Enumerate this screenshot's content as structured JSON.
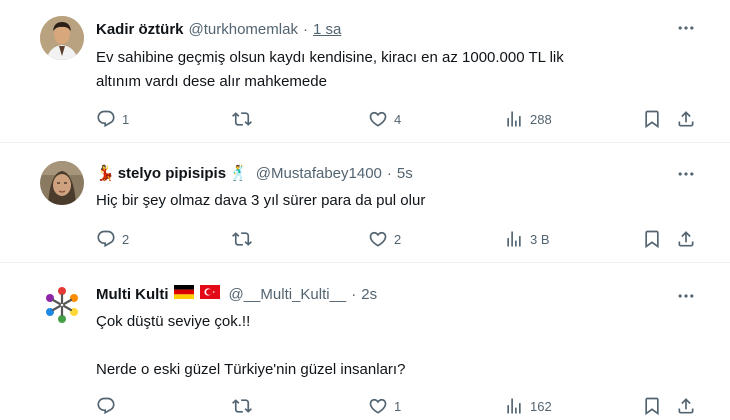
{
  "posts": [
    {
      "name": "Kadir öztürk",
      "handle": "@turkhomemlak",
      "separator": "·",
      "time": "1 sa",
      "text": [
        "Ev sahibine geçmiş olsun kaydı kendisine, kiracı en az 1000.000 TL lik",
        "altınım vardı dese alır mahkemede"
      ],
      "replies": "1",
      "reposts": "",
      "likes": "4",
      "views": "288"
    },
    {
      "name_emoji_left": "💃",
      "name": "stelyo pipisipis",
      "name_emoji_right": "🕺",
      "handle": "@Mustafabey1400",
      "separator": "·",
      "time": "5s",
      "text": [
        "Hiç bir şey olmaz dava 3 yıl sürer para da pul olur"
      ],
      "replies": "2",
      "reposts": "",
      "likes": "2",
      "views": "3 B"
    },
    {
      "name": "Multi Kulti",
      "name_flags": [
        "🇩🇪",
        "🇹🇷"
      ],
      "handle": "@__Multi_Kulti__",
      "separator": "·",
      "time": "2s",
      "text": [
        "Çok düştü seviye çok.!!",
        "",
        "Nerde o eski güzel Türkiye'nin güzel insanları?"
      ],
      "replies": "",
      "reposts": "",
      "likes": "1",
      "views": "162"
    }
  ],
  "icons": {
    "reply": "reply-icon",
    "repost": "repost-icon",
    "like": "like-icon",
    "views": "views-icon",
    "bookmark": "bookmark-icon",
    "share": "share-icon",
    "more": "more-icon"
  },
  "colors": {
    "text": "#0f1419",
    "secondary": "#536471",
    "divider": "#eff3f4",
    "flag_red": "#e30a17"
  }
}
